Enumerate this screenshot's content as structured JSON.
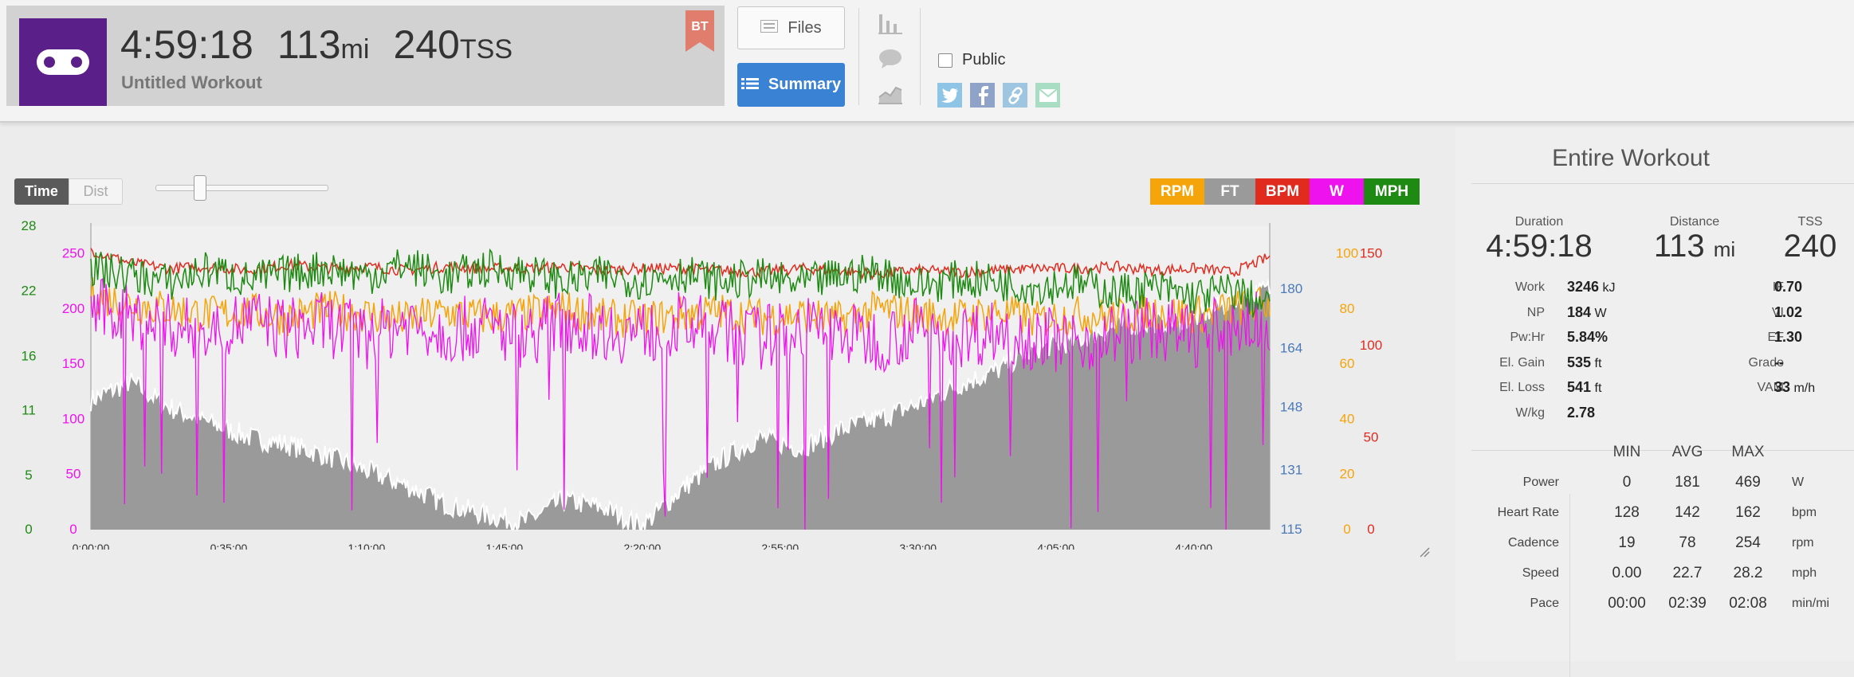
{
  "header": {
    "duration": "4:59:18",
    "distance": "113",
    "distance_unit": "mi",
    "tss": "240",
    "tss_unit": "TSS",
    "workout_title": "Untitled Workout",
    "badge": "BT"
  },
  "toolbar": {
    "files_label": "Files",
    "summary_label": "Summary"
  },
  "share": {
    "public_label": "Public"
  },
  "chart_controls": {
    "time_label": "Time",
    "dist_label": "Dist"
  },
  "legend": [
    {
      "label": "RPM",
      "color": "#f5a40a"
    },
    {
      "label": "FT",
      "color": "#9a9a9a"
    },
    {
      "label": "BPM",
      "color": "#e12b1f"
    },
    {
      "label": "W",
      "color": "#ee12ee"
    },
    {
      "label": "MPH",
      "color": "#1e8a13"
    }
  ],
  "chart_data": {
    "type": "line",
    "x_ticks": [
      "0:00:00",
      "0:35:00",
      "1:10:00",
      "1:45:00",
      "2:20:00",
      "2:55:00",
      "3:30:00",
      "4:05:00",
      "4:40:00"
    ],
    "x_range_min": [
      0,
      299.3
    ],
    "axes": [
      {
        "series": "MPH",
        "color": "#1e8a13",
        "side": "left",
        "ticks": [
          "0",
          "5",
          "11",
          "16",
          "22",
          "28"
        ],
        "range": [
          0,
          28
        ]
      },
      {
        "series": "W",
        "color": "#ee12ee",
        "side": "left",
        "ticks": [
          "0",
          "50",
          "100",
          "150",
          "200",
          "250"
        ],
        "range": [
          0,
          275
        ]
      },
      {
        "series": "FT",
        "color": "#4a7ab8",
        "side": "right",
        "ticks": [
          "115",
          "131",
          "148",
          "164",
          "180"
        ],
        "range": [
          115,
          197
        ]
      },
      {
        "series": "RPM",
        "color": "#f5a40a",
        "side": "right",
        "ticks": [
          "0",
          "20",
          "40",
          "60",
          "80",
          "100"
        ],
        "range": [
          0,
          110
        ]
      },
      {
        "series": "BPM",
        "color": "#e12b1f",
        "side": "right",
        "ticks": [
          "0",
          "50",
          "100",
          "150"
        ],
        "range": [
          0,
          165
        ]
      }
    ],
    "series": [
      {
        "name": "FT",
        "type": "area",
        "x_min": [
          0,
          10,
          20,
          30,
          40,
          50,
          60,
          70,
          80,
          90,
          100,
          110,
          120,
          130,
          140,
          150,
          160,
          170,
          180,
          190,
          200,
          210,
          220,
          230,
          240,
          250,
          260,
          270,
          280,
          290,
          299
        ],
        "values": [
          150,
          155,
          148,
          144,
          140,
          138,
          135,
          131,
          127,
          122,
          119,
          117,
          123,
          121,
          116,
          126,
          134,
          140,
          137,
          142,
          145,
          149,
          154,
          158,
          164,
          166,
          170,
          171,
          172,
          177,
          180
        ]
      },
      {
        "name": "BPM",
        "type": "line",
        "x_min": [
          0,
          10,
          20,
          30,
          40,
          50,
          60,
          70,
          80,
          90,
          100,
          110,
          120,
          130,
          140,
          150,
          160,
          170,
          180,
          190,
          200,
          210,
          220,
          230,
          240,
          250,
          260,
          270,
          280,
          290,
          299
        ],
        "values": [
          152,
          145,
          142,
          143,
          141,
          144,
          142,
          143,
          141,
          143,
          142,
          142,
          143,
          141,
          142,
          142,
          141,
          140,
          142,
          141,
          139,
          141,
          140,
          141,
          142,
          142,
          143,
          141,
          142,
          140,
          148
        ]
      },
      {
        "name": "RPM",
        "type": "line",
        "x_min": [
          0,
          10,
          20,
          30,
          40,
          50,
          60,
          70,
          80,
          90,
          100,
          110,
          120,
          130,
          140,
          150,
          160,
          170,
          180,
          190,
          200,
          210,
          220,
          230,
          240,
          250,
          260,
          270,
          280,
          290,
          299
        ],
        "values": [
          85,
          82,
          80,
          78,
          79,
          77,
          80,
          78,
          76,
          79,
          77,
          78,
          80,
          77,
          76,
          78,
          79,
          77,
          78,
          76,
          80,
          78,
          77,
          79,
          76,
          78,
          77,
          79,
          78,
          80,
          82
        ]
      },
      {
        "name": "W",
        "type": "line",
        "x_min": [
          0,
          10,
          20,
          30,
          40,
          50,
          60,
          70,
          80,
          90,
          100,
          110,
          120,
          130,
          140,
          150,
          160,
          170,
          180,
          190,
          200,
          210,
          220,
          230,
          240,
          250,
          260,
          270,
          280,
          290,
          299
        ],
        "values": [
          200,
          192,
          185,
          178,
          190,
          182,
          186,
          175,
          188,
          180,
          184,
          176,
          190,
          182,
          178,
          186,
          180,
          174,
          184,
          178,
          172,
          182,
          176,
          180,
          174,
          170,
          178,
          182,
          176,
          184,
          188
        ]
      },
      {
        "name": "MPH",
        "type": "line",
        "x_min": [
          0,
          10,
          20,
          30,
          40,
          50,
          60,
          70,
          80,
          90,
          100,
          110,
          120,
          130,
          140,
          150,
          160,
          170,
          180,
          190,
          200,
          210,
          220,
          230,
          240,
          250,
          260,
          270,
          280,
          290,
          299
        ],
        "values": [
          24,
          23.5,
          22.8,
          24,
          23,
          23.6,
          24.2,
          23.4,
          24.5,
          23.2,
          24.1,
          23.8,
          22.9,
          23.5,
          23,
          23.7,
          22.8,
          23.3,
          22.6,
          23.4,
          23.8,
          22.5,
          23.1,
          22.9,
          22.4,
          22.8,
          21.9,
          22.3,
          21.5,
          22.1,
          20.5
        ]
      }
    ]
  },
  "summary": {
    "title": "Entire Workout",
    "duration_label": "Duration",
    "duration": "4:59:18",
    "distance_label": "Distance",
    "distance": "113",
    "distance_unit": "mi",
    "tss_label": "TSS",
    "tss": "240",
    "left_metrics": [
      {
        "label": "Work",
        "value": "3246",
        "unit": "kJ"
      },
      {
        "label": "NP",
        "value": "184",
        "unit": "W"
      },
      {
        "label": "Pw:Hr",
        "value": "5.84%",
        "unit": ""
      },
      {
        "label": "El. Gain",
        "value": "535",
        "unit": "ft"
      },
      {
        "label": "El. Loss",
        "value": "541",
        "unit": "ft"
      },
      {
        "label": "W/kg",
        "value": "2.78",
        "unit": ""
      }
    ],
    "right_metrics": [
      {
        "label": "IF",
        "value": "0.70",
        "unit": ""
      },
      {
        "label": "VI",
        "value": "1.02",
        "unit": ""
      },
      {
        "label": "EF",
        "value": "1.30",
        "unit": ""
      },
      {
        "label": "Grade",
        "value": "--",
        "unit": ""
      },
      {
        "label": "VAM",
        "value": "33",
        "unit": "m/h"
      }
    ],
    "table_headers": [
      "MIN",
      "AVG",
      "MAX"
    ],
    "table_rows": [
      {
        "label": "Power",
        "min": "0",
        "avg": "181",
        "max": "469",
        "unit": "W"
      },
      {
        "label": "Heart Rate",
        "min": "128",
        "avg": "142",
        "max": "162",
        "unit": "bpm"
      },
      {
        "label": "Cadence",
        "min": "19",
        "avg": "78",
        "max": "254",
        "unit": "rpm"
      },
      {
        "label": "Speed",
        "min": "0.00",
        "avg": "22.7",
        "max": "28.2",
        "unit": "mph"
      },
      {
        "label": "Pace",
        "min": "00:00",
        "avg": "02:39",
        "max": "02:08",
        "unit": "min/mi"
      }
    ]
  }
}
